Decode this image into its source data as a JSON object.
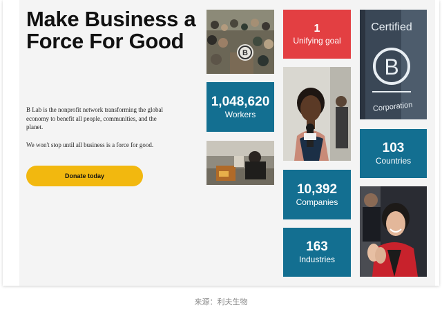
{
  "hero": {
    "headline": "Make Business a Force For Good",
    "paragraph1": "B Lab is the nonprofit network transforming the global economy to benefit all people, communities, and the planet.",
    "paragraph2": "We won't stop until all business is a force for good.",
    "donate_label": "Donate today"
  },
  "stats": {
    "unifying_goal": {
      "value": "1",
      "label": "Unifying goal"
    },
    "workers": {
      "value": "1,048,620",
      "label": "Workers"
    },
    "countries": {
      "value": "103",
      "label": "Countries"
    },
    "companies": {
      "value": "10,392",
      "label": "Companies"
    },
    "industries": {
      "value": "163",
      "label": "Industries"
    }
  },
  "certified_sign": {
    "line1": "Certified",
    "letter": "B",
    "line2": "Corporation"
  },
  "caption": "来源：利夫生物",
  "colors": {
    "blue": "#136f91",
    "red": "#e33f42",
    "yellow": "#f2b80f",
    "background": "#f4f4f4"
  }
}
